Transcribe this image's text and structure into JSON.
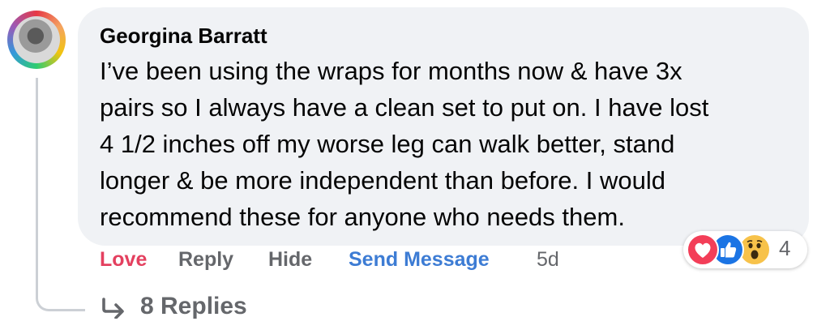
{
  "comment": {
    "author": "Georgina Barratt",
    "text": "I’ve been using the wraps for months now & have 3x\npairs so I always have a clean set to put on. I have lost\n4 1/2 inches off my worse leg can walk better, stand\nlonger & be more independent than before. I would\nrecommend these for anyone who needs them.",
    "actions": {
      "love": "Love",
      "reply": "Reply",
      "hide": "Hide",
      "send_message": "Send Message",
      "time": "5d"
    },
    "reactions": {
      "icons": [
        "love-icon",
        "like-icon",
        "wow-icon"
      ],
      "count": "4"
    },
    "replies_label": "8 Replies"
  },
  "colors": {
    "love": "#e4405f",
    "send_message": "#3d7cd4",
    "muted": "#65676b",
    "bubble_bg": "#f0f2f5"
  }
}
